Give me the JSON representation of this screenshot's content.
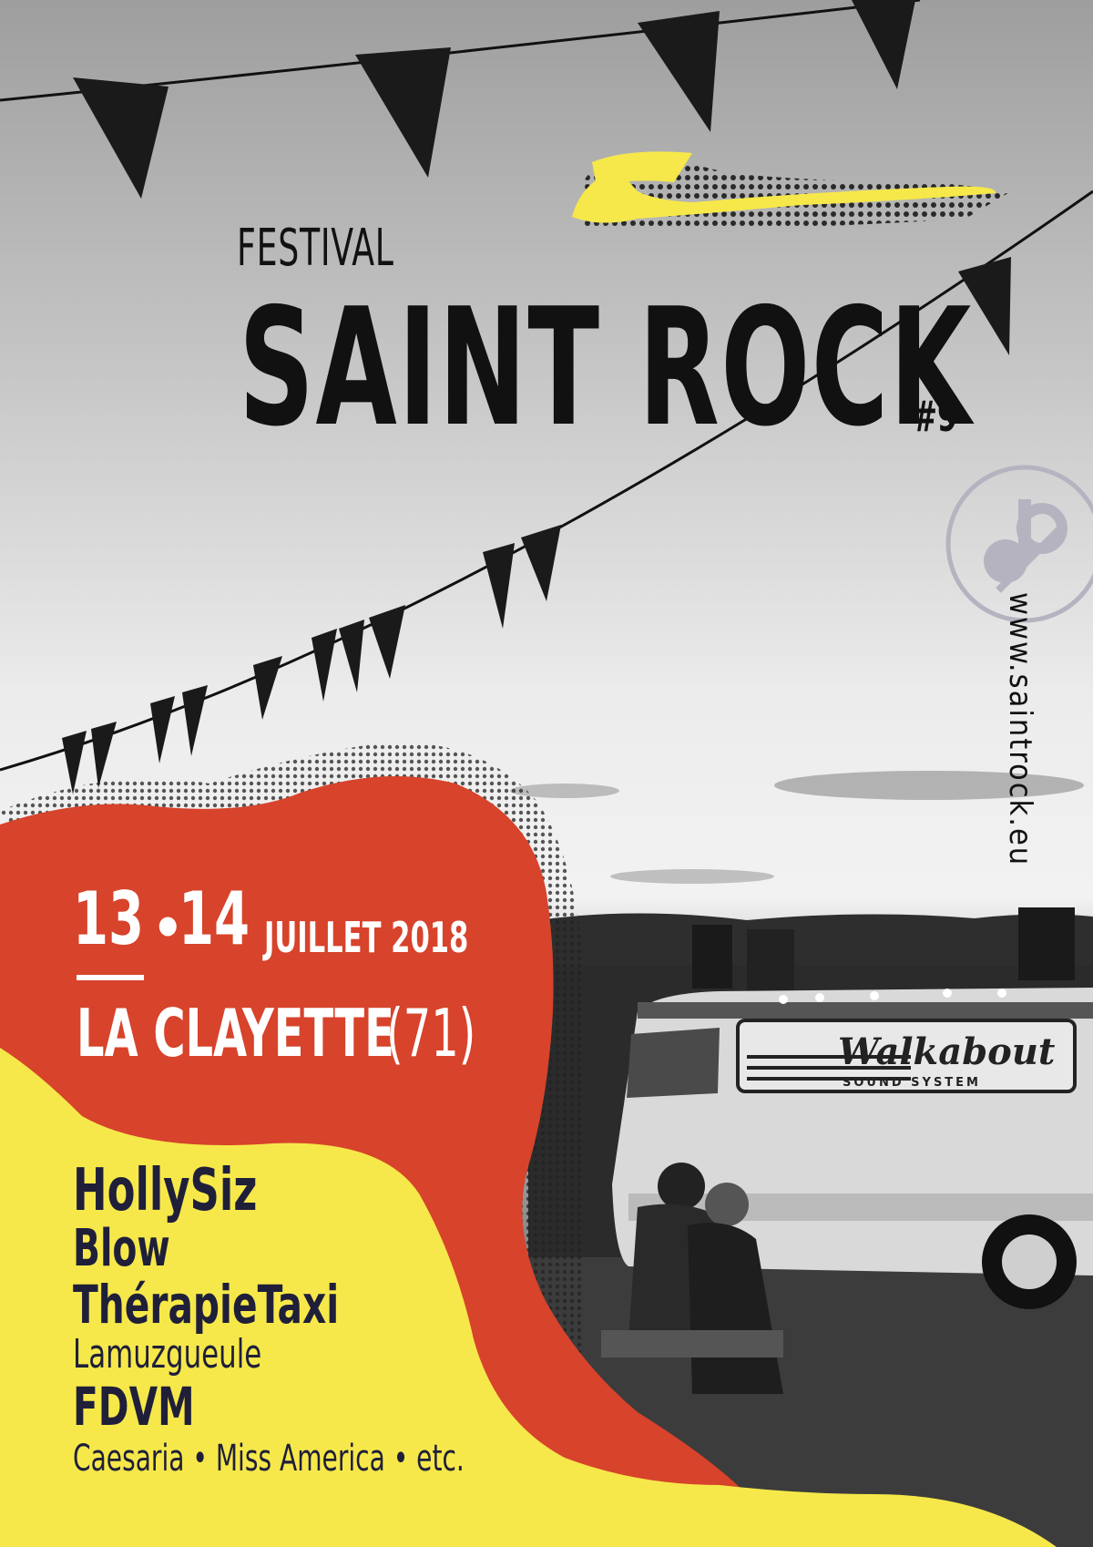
{
  "festival_label": "FESTIVAL",
  "festival_name": "SAINT ROCK",
  "edition": "#9",
  "website": "www.saintrock.eu",
  "dates": {
    "day1": "13",
    "separator": "•",
    "day2": "14",
    "month_year": "JUILLET 2018"
  },
  "location": {
    "city": "LA CLAYETTE",
    "department": "(71)"
  },
  "lineup": [
    "HollySiz",
    "Blow",
    "ThérapieTaxi",
    "Lamuzgueule",
    "FDVM",
    "Caesaria • Miss America • etc."
  ],
  "van_sign": {
    "brand": "Walkabout",
    "subtitle": "SOUND SYSTEM"
  },
  "colors": {
    "red": "#d7432b",
    "yellow": "#f6e84a",
    "dark_text": "#1f1f3a"
  }
}
